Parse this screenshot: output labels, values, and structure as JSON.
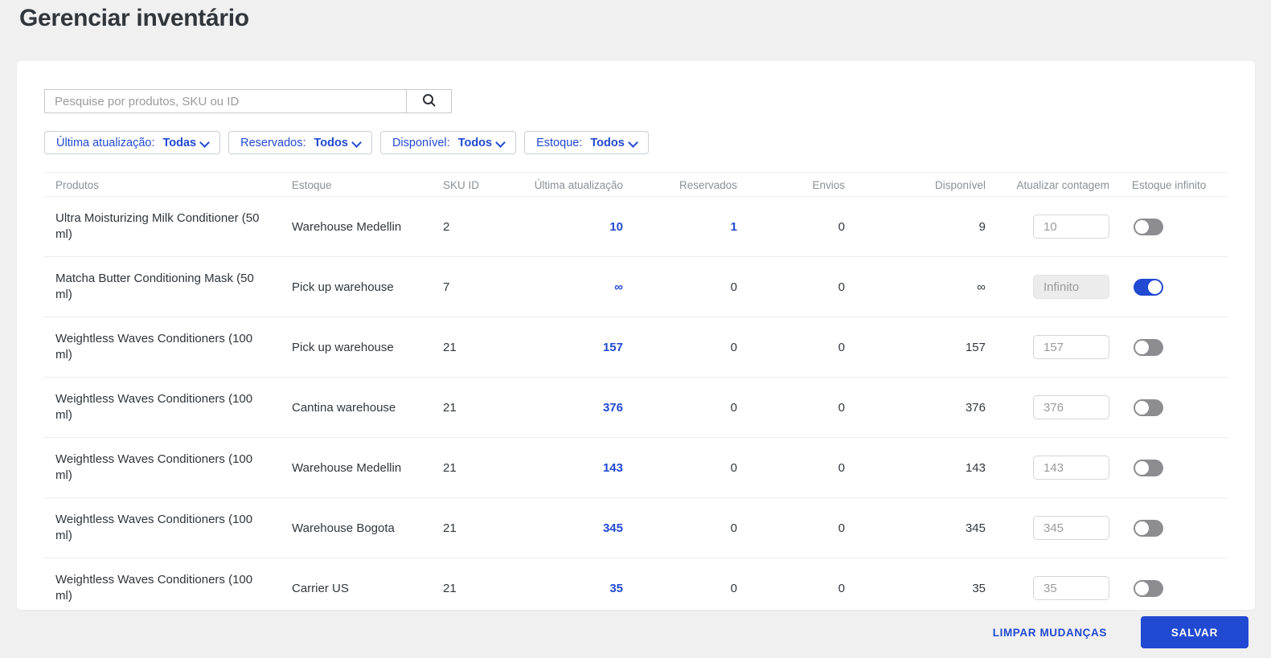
{
  "page": {
    "title": "Gerenciar inventário"
  },
  "search": {
    "placeholder": "Pesquise por produtos, SKU ou ID"
  },
  "filters": [
    {
      "label": "Última atualização:",
      "value": "Todas"
    },
    {
      "label": "Reservados:",
      "value": "Todos"
    },
    {
      "label": "Disponível:",
      "value": "Todos"
    },
    {
      "label": "Estoque:",
      "value": "Todos"
    }
  ],
  "table": {
    "headers": [
      "Produtos",
      "Estoque",
      "SKU ID",
      "Última atualização",
      "Reservados",
      "Envios",
      "Disponível",
      "Atualizar contagem",
      "Estoque infinito"
    ],
    "rows": [
      {
        "product": "Ultra Moisturizing Milk Conditioner (50 ml)",
        "warehouse": "Warehouse Medellin",
        "sku": "2",
        "last_update": "10",
        "reserved": "1",
        "reserved_link": true,
        "shipments": "0",
        "available": "9",
        "count_value": "10",
        "infinite": false
      },
      {
        "product": "Matcha Butter Conditioning Mask (50 ml)",
        "warehouse": "Pick up warehouse",
        "sku": "7",
        "last_update": "∞",
        "reserved": "0",
        "reserved_link": false,
        "shipments": "0",
        "available": "∞",
        "count_value": "Infinito",
        "infinite": true
      },
      {
        "product": "Weightless Waves Conditioners (100 ml)",
        "warehouse": "Pick up warehouse",
        "sku": "21",
        "last_update": "157",
        "reserved": "0",
        "reserved_link": false,
        "shipments": "0",
        "available": "157",
        "count_value": "157",
        "infinite": false
      },
      {
        "product": "Weightless Waves Conditioners (100 ml)",
        "warehouse": "Cantina warehouse",
        "sku": "21",
        "last_update": "376",
        "reserved": "0",
        "reserved_link": false,
        "shipments": "0",
        "available": "376",
        "count_value": "376",
        "infinite": false
      },
      {
        "product": "Weightless Waves Conditioners (100 ml)",
        "warehouse": "Warehouse Medellin",
        "sku": "21",
        "last_update": "143",
        "reserved": "0",
        "reserved_link": false,
        "shipments": "0",
        "available": "143",
        "count_value": "143",
        "infinite": false
      },
      {
        "product": "Weightless Waves Conditioners (100 ml)",
        "warehouse": "Warehouse Bogota",
        "sku": "21",
        "last_update": "345",
        "reserved": "0",
        "reserved_link": false,
        "shipments": "0",
        "available": "345",
        "count_value": "345",
        "infinite": false
      },
      {
        "product": "Weightless Waves Conditioners (100 ml)",
        "warehouse": "Carrier US",
        "sku": "21",
        "last_update": "35",
        "reserved": "0",
        "reserved_link": false,
        "shipments": "0",
        "available": "35",
        "count_value": "35",
        "infinite": false
      }
    ]
  },
  "footer": {
    "clear_label": "LIMPAR MUDANÇAS",
    "save_label": "SALVAR"
  },
  "colors": {
    "accent": "#2149d1",
    "toggle_off": "#8d8d90",
    "page_background": "#f0f0f1",
    "header_text": "#8b9095"
  }
}
